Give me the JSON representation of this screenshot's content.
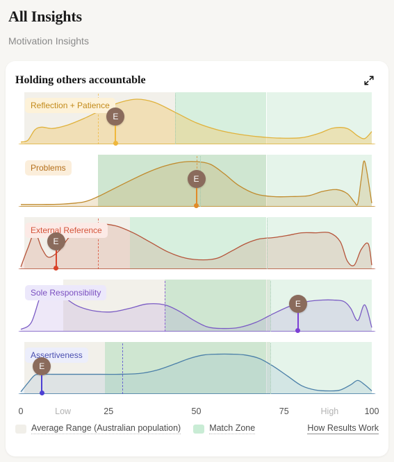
{
  "header": {
    "title": "All Insights",
    "subtitle": "Motivation Insights"
  },
  "card": {
    "title": "Holding others accountable",
    "expand_icon": "expand-diagonal-arrows-icon"
  },
  "axis": {
    "ticks": [
      {
        "label": "0",
        "value": 0,
        "kind": "num"
      },
      {
        "label": "Low",
        "value": 12,
        "kind": "word"
      },
      {
        "label": "25",
        "value": 25,
        "kind": "num"
      },
      {
        "label": "50",
        "value": 50,
        "kind": "num"
      },
      {
        "label": "75",
        "value": 75,
        "kind": "num"
      },
      {
        "label": "High",
        "value": 88,
        "kind": "word"
      },
      {
        "label": "100",
        "value": 100,
        "kind": "num"
      }
    ]
  },
  "legend": {
    "items": [
      {
        "label": "Average Range (Australian population)",
        "color": "#f1efe9"
      },
      {
        "label": "Match Zone",
        "color": "#c9ecd5"
      }
    ],
    "link": "How Results Work"
  },
  "chart_data": {
    "type": "area",
    "title": "Holding others accountable",
    "subtitle": "Motivation Insights",
    "xlabel": "",
    "ylabel": "",
    "xlim": [
      0,
      100
    ],
    "grid": false,
    "legend_position": "bottom",
    "series": [
      {
        "name": "Reflection + Patience",
        "line_color": "#e0b23c",
        "fill_color": "rgba(240, 200, 110, 0.42)",
        "label_bg": "#fdf2d9",
        "label_color": "#c38b1b",
        "stem_color": "#efb73c",
        "score": 27,
        "score_letter": "E",
        "average_range": [
          1,
          44
        ],
        "match_zone": [
          44,
          100
        ],
        "match_zone_dark_until": 70,
        "dash_line": 22,
        "dot_line": 44,
        "x": [
          0,
          2,
          4,
          6,
          9,
          13,
          18,
          23,
          28,
          33,
          38,
          44,
          50,
          56,
          62,
          68,
          74,
          80,
          85,
          89,
          93,
          96,
          98,
          100
        ],
        "y": [
          0.02,
          0.06,
          0.3,
          0.36,
          0.33,
          0.4,
          0.56,
          0.75,
          0.92,
          1.0,
          0.93,
          0.7,
          0.46,
          0.3,
          0.2,
          0.14,
          0.11,
          0.12,
          0.22,
          0.34,
          0.33,
          0.16,
          0.1,
          0.26
        ]
      },
      {
        "name": "Problems",
        "line_color": "#c08a2c",
        "fill_color": "rgba(198, 150, 60, 0.22)",
        "label_bg": "#fbeedb",
        "label_color": "#b5701c",
        "stem_color": "#e08a28",
        "score": 50,
        "score_letter": "E",
        "average_range": [
          22,
          70
        ],
        "match_zone": [
          22,
          100
        ],
        "match_zone_dark_until": 70,
        "dash_line": 50,
        "dot_line": 51,
        "x": [
          0,
          6,
          12,
          18,
          22,
          26,
          31,
          36,
          41,
          46,
          50,
          54,
          58,
          62,
          67,
          72,
          77,
          82,
          86,
          90,
          93,
          95,
          96,
          97,
          98,
          100
        ],
        "y": [
          0.02,
          0.02,
          0.03,
          0.08,
          0.2,
          0.36,
          0.56,
          0.75,
          0.9,
          0.99,
          1.0,
          0.94,
          0.72,
          0.46,
          0.26,
          0.2,
          0.2,
          0.22,
          0.32,
          0.36,
          0.27,
          0.08,
          0.04,
          0.6,
          1.0,
          0.05
        ]
      },
      {
        "name": "External Reference",
        "line_color": "#b5543a",
        "fill_color": "rgba(201, 108, 80, 0.18)",
        "label_bg": "#fceae6",
        "label_color": "#d4543a",
        "stem_color": "#d9432a",
        "score": 10,
        "score_letter": "E",
        "average_range": [
          1,
          31
        ],
        "match_zone": [
          31,
          100
        ],
        "match_zone_dark_until": 70,
        "dash_line": 22,
        "dot_line": 70,
        "x": [
          0,
          2,
          4,
          6,
          8,
          11,
          14,
          18,
          22,
          27,
          32,
          37,
          42,
          47,
          52,
          56,
          60,
          64,
          68,
          72,
          76,
          80,
          84,
          88,
          91,
          93,
          95,
          97,
          99,
          100
        ],
        "y": [
          0.02,
          0.45,
          0.8,
          0.44,
          0.24,
          0.4,
          0.72,
          0.93,
          1.0,
          0.96,
          0.8,
          0.58,
          0.36,
          0.22,
          0.18,
          0.22,
          0.38,
          0.55,
          0.66,
          0.69,
          0.74,
          0.8,
          0.8,
          0.8,
          0.6,
          0.16,
          0.06,
          0.42,
          0.55,
          0.06
        ]
      },
      {
        "name": "Sole Responsibility",
        "line_color": "#7a5bc4",
        "fill_color": "rgba(150, 110, 210, 0.16)",
        "label_bg": "#ece8fb",
        "label_color": "#7a4fc0",
        "stem_color": "#7c3fd4",
        "score": 79,
        "score_letter": "E",
        "average_range": [
          12,
          71
        ],
        "match_zone": [
          41,
          100
        ],
        "match_zone_dark_until": 70,
        "dash_line": 41,
        "dot_line": 71,
        "x": [
          0,
          3,
          6,
          9,
          12,
          16,
          21,
          26,
          31,
          36,
          41,
          45,
          49,
          53,
          57,
          62,
          67,
          72,
          77,
          82,
          86,
          89,
          92,
          94,
          96,
          98,
          100
        ],
        "y": [
          0.02,
          0.18,
          0.86,
          0.98,
          0.78,
          0.56,
          0.44,
          0.42,
          0.5,
          0.6,
          0.58,
          0.44,
          0.24,
          0.08,
          0.04,
          0.06,
          0.18,
          0.38,
          0.56,
          0.66,
          0.69,
          0.69,
          0.66,
          0.5,
          0.22,
          0.58,
          0.06
        ]
      },
      {
        "name": "Assertiveness",
        "line_color": "#4a7fa8",
        "fill_color": "rgba(120, 160, 200, 0.16)",
        "label_bg": "#eceefb",
        "label_color": "#4a4fb0",
        "stem_color": "#4c3fd4",
        "score": 6,
        "score_letter": "E",
        "average_range": [
          1,
          71
        ],
        "match_zone": [
          24,
          100
        ],
        "match_zone_dark_until": 70,
        "dash_line": 29,
        "dot_line": 71,
        "x": [
          0,
          2,
          4,
          6,
          9,
          13,
          20,
          28,
          34,
          39,
          44,
          48,
          52,
          56,
          60,
          64,
          68,
          72,
          76,
          80,
          84,
          88,
          91,
          94,
          96,
          98,
          100
        ],
        "y": [
          0.02,
          0.22,
          0.4,
          0.42,
          0.42,
          0.42,
          0.42,
          0.42,
          0.44,
          0.52,
          0.66,
          0.78,
          0.86,
          0.88,
          0.88,
          0.86,
          0.78,
          0.6,
          0.38,
          0.16,
          0.06,
          0.04,
          0.06,
          0.18,
          0.28,
          0.18,
          0.04
        ]
      }
    ]
  }
}
